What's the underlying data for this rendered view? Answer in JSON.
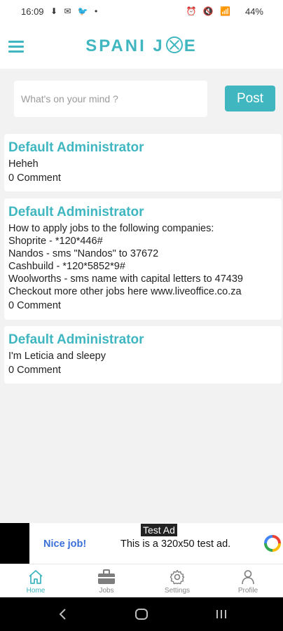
{
  "status_bar": {
    "time": "16:09",
    "left_icons": "⬇ ✉ 🐦 •",
    "right_icons": "⏰ 🔇 📶",
    "battery": "44%"
  },
  "header": {
    "logo_left": "SPANI J",
    "logo_right": "E"
  },
  "composer": {
    "placeholder": "What's on your mind ?",
    "post_label": "Post"
  },
  "posts": [
    {
      "author": "Default Administrator",
      "body": "Heheh",
      "comments": "0 Comment"
    },
    {
      "author": "Default Administrator",
      "body": "How to apply jobs to the following companies:\nShoprite - *120*446#\nNandos - sms \"Nandos\" to 37672\nCashbuild - *120*5852*9#\nWoolworths - sms name with capital letters to 47439\nCheckout more other jobs here www.liveoffice.co.za",
      "comments": "0 Comment"
    },
    {
      "author": "Default Administrator",
      "body": "I'm Leticia and sleepy",
      "comments": "0 Comment"
    }
  ],
  "ad": {
    "label": "Test Ad",
    "headline": "Nice job!",
    "text": "This is a 320x50 test ad."
  },
  "bottom_nav": {
    "items": [
      {
        "label": "Home",
        "icon": "home-icon",
        "active": true
      },
      {
        "label": "Jobs",
        "icon": "briefcase-icon",
        "active": false
      },
      {
        "label": "Settings",
        "icon": "gear-icon",
        "active": false
      },
      {
        "label": "Profile",
        "icon": "person-icon",
        "active": false
      }
    ]
  },
  "colors": {
    "accent": "#3fb6c0",
    "background": "#f2f2f2"
  }
}
